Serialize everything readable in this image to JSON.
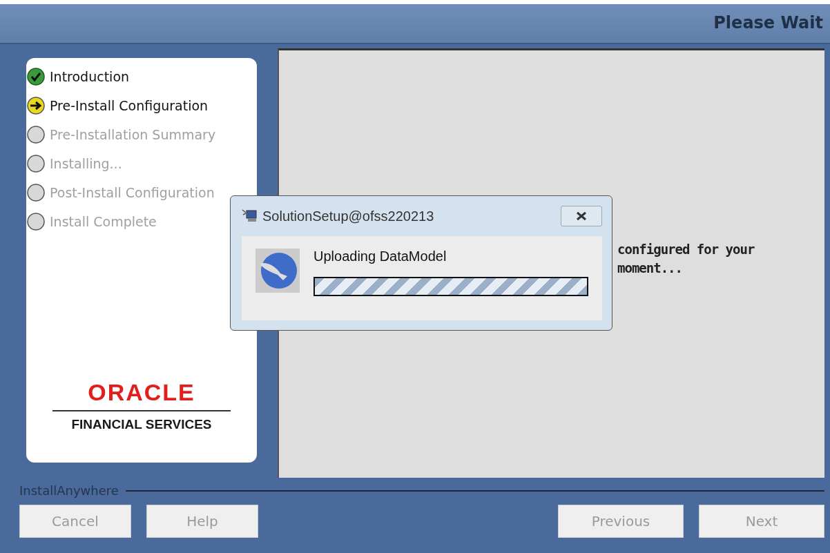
{
  "header": {
    "title": "Please Wait"
  },
  "steps": [
    {
      "label": "Introduction",
      "kind": "done"
    },
    {
      "label": "Pre-Install Configuration",
      "kind": "current"
    },
    {
      "label": "Pre-Installation Summary",
      "kind": "pending"
    },
    {
      "label": "Installing...",
      "kind": "pending"
    },
    {
      "label": "Post-Install Configuration",
      "kind": "pending"
    },
    {
      "label": "Install Complete",
      "kind": "pending"
    }
  ],
  "logo": {
    "brand": "ORACLE",
    "subtitle": "FINANCIAL SERVICES"
  },
  "content": {
    "message_lines": [
      "configured for your",
      "moment..."
    ]
  },
  "dialog": {
    "title": "SolutionSetup@ofss220213",
    "message": "Uploading DataModel",
    "progress": {
      "level": 1
    }
  },
  "footer": {
    "vendor": "InstallAnywhere",
    "left_buttons": [
      {
        "label": "Cancel",
        "disabled": true
      },
      {
        "label": "Help",
        "disabled": true
      }
    ],
    "right_buttons": [
      {
        "label": "Previous",
        "disabled": true
      },
      {
        "label": "Next",
        "disabled": true
      }
    ]
  }
}
